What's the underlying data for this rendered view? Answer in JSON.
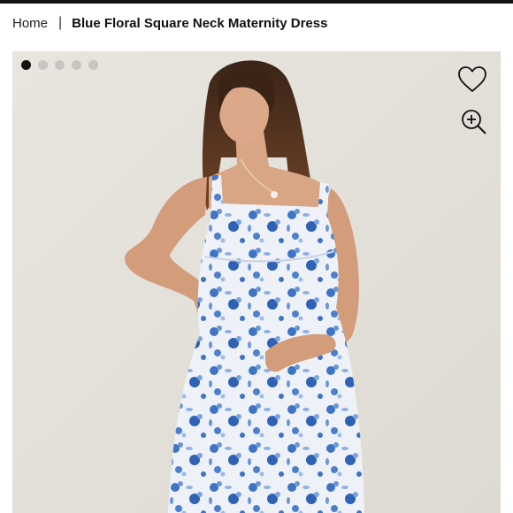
{
  "breadcrumb": {
    "home": "Home",
    "current": "Blue Floral Square Neck Maternity Dress"
  },
  "gallery": {
    "slide_count": 5,
    "active_index": 0
  },
  "icons": {
    "favorite": "heart-outline-icon",
    "zoom": "zoom-in-icon"
  },
  "colors": {
    "accent": "#111111",
    "background": "#e6e3dd",
    "dress_blue": "#3f73c4"
  }
}
